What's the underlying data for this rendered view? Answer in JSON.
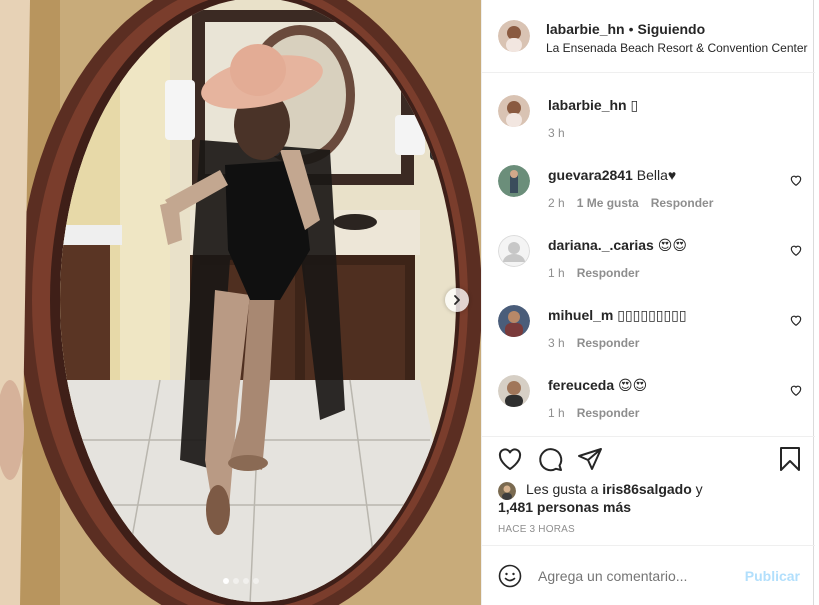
{
  "post": {
    "username": "labarbie_hn",
    "separator": "•",
    "follow_status": "Siguiendo",
    "location": "La Ensenada Beach Resort & Convention Center"
  },
  "caption": {
    "username": "labarbie_hn",
    "text": "▯",
    "time": "3 h"
  },
  "comments": [
    {
      "username": "guevara2841",
      "text": "Bella♥",
      "time": "2 h",
      "likes": "1 Me gusta",
      "reply": "Responder"
    },
    {
      "username": "dariana._.carias",
      "text": "😍😍",
      "time": "1 h",
      "reply": "Responder"
    },
    {
      "username": "mihuel_m",
      "text": "▯▯▯▯▯▯▯▯▯",
      "time": "3 h",
      "reply": "Responder"
    },
    {
      "username": "fereuceda",
      "text": "😍😍",
      "time": "1 h",
      "reply": "Responder"
    }
  ],
  "likes": {
    "prefix": "Les gusta a ",
    "user": "iris86salgado",
    "conj": " y",
    "others": "1,481 personas más"
  },
  "time_ago": "HACE 3 HORAS",
  "add_comment": {
    "placeholder": "Agrega un comentario...",
    "publish": "Publicar"
  },
  "carousel": {
    "count": 4,
    "active": 0
  },
  "icons": {
    "like": "heart-icon",
    "comment": "comment-bubble-icon",
    "share": "paper-plane-icon",
    "save": "bookmark-icon",
    "emoji": "smiley-icon",
    "next": "chevron-right-icon"
  },
  "colors": {
    "link": "#b2dffc",
    "muted": "#8e8e8e",
    "text": "#262626",
    "border": "#efefef"
  }
}
